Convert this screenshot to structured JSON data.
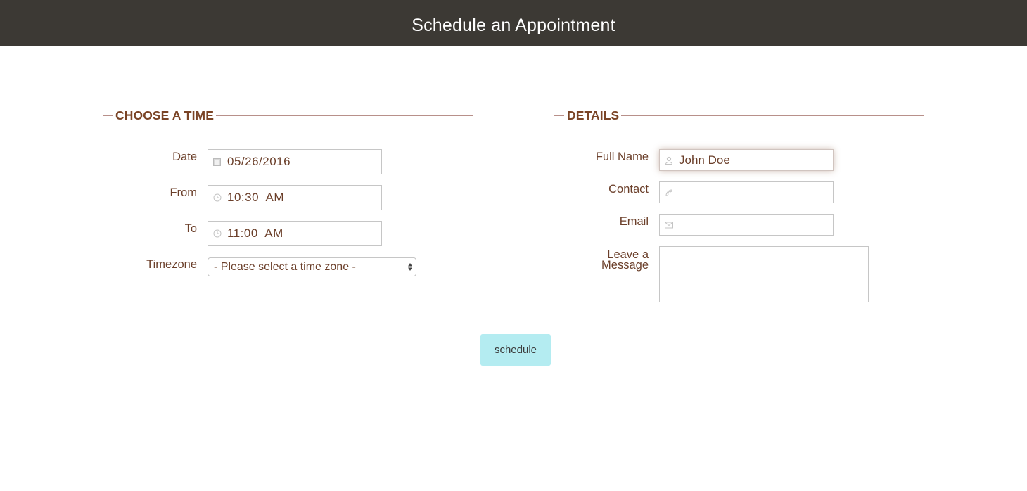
{
  "header": {
    "title": "Schedule an Appointment"
  },
  "choose_time": {
    "title": "CHOOSE A TIME",
    "date": {
      "label": "Date",
      "value": "05/26/2016",
      "icon": "calendar-icon"
    },
    "from": {
      "label": "From",
      "value": "10:30  AM",
      "icon": "clock-icon"
    },
    "to": {
      "label": "To",
      "value": "11:00  AM",
      "icon": "clock-icon"
    },
    "timezone": {
      "label": "Timezone",
      "selected": "- Please select a time zone -"
    }
  },
  "details": {
    "title": "DETAILS",
    "full_name": {
      "label": "Full Name",
      "value": "John Doe",
      "icon": "user-icon"
    },
    "contact": {
      "label": "Contact",
      "value": "",
      "icon": "phone-icon"
    },
    "email": {
      "label": "Email",
      "value": "",
      "icon": "envelope-icon"
    },
    "message": {
      "label_line1": "Leave a",
      "label_line2": "Message",
      "value": ""
    }
  },
  "actions": {
    "schedule_label": "schedule"
  },
  "colors": {
    "header_bg": "#3c3934",
    "accent_text": "#7a4426",
    "rule": "#b8908a",
    "button_bg": "#b4ecf1"
  }
}
